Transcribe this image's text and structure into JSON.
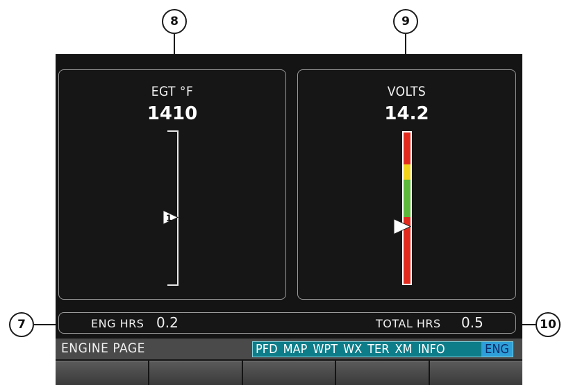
{
  "callouts": {
    "c7": "7",
    "c8": "8",
    "c9": "9",
    "c10": "10"
  },
  "egt_gauge": {
    "title": "EGT °F",
    "value": "1410",
    "pointer_label": "1",
    "pointer_level": 0.44
  },
  "volts_gauge": {
    "title": "VOLTS",
    "value": "14.2",
    "pointer_level": 0.38,
    "colors": {
      "red": "#e22b1f",
      "yellow": "#f2d21a",
      "green": "#5cb83a"
    }
  },
  "hours": {
    "eng_label": "ENG HRS",
    "eng_value": "0.2",
    "total_label": "TOTAL HRS",
    "total_value": "0.5"
  },
  "nav": {
    "page_title": "ENGINE PAGE",
    "pages": [
      "PFD",
      "MAP",
      "WPT",
      "WX",
      "TER",
      "XM",
      "INFO"
    ],
    "active_page": "ENG"
  },
  "accent": {
    "page_group": "#0e7d8a",
    "active": "#2e9fd8"
  }
}
